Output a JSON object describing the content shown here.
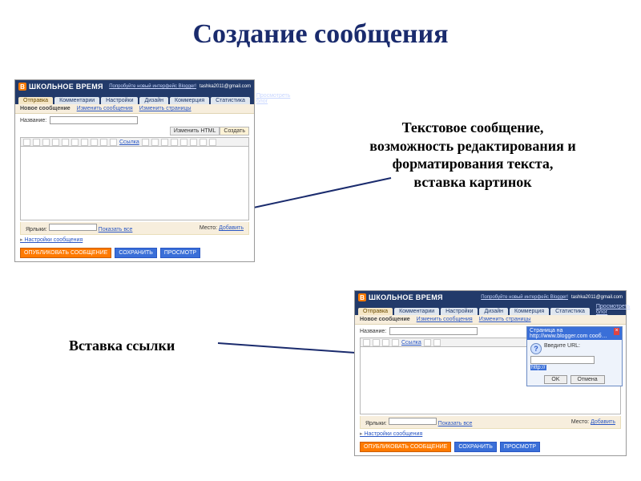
{
  "title": "Создание сообщения",
  "annotation1": "Текстовое сообщение, возможность редактирования и форматирования текста, вставка картинок",
  "annotation2": "Вставка ссылки",
  "blogger": {
    "siteName": "ШКОЛЬНОЕ ВРЕМЯ",
    "tryNew": "Попробуйте новый интерфейс Blogger!",
    "email": "tashka2011@gmail.com",
    "tabs": {
      "posting": "Отправка",
      "comments": "Комментарии",
      "settings": "Настройки",
      "design": "Дизайн",
      "monetize": "Коммерция",
      "stats": "Статистика"
    },
    "viewBlog": "Просмотреть блог",
    "sub": {
      "newPost": "Новое сообщение",
      "editPosts": "Изменить сообщения",
      "editPages": "Изменить страницы"
    },
    "titleLabel": "Название:",
    "mode": {
      "html": "Изменить HTML",
      "compose": "Создать"
    },
    "toolbar": {
      "link": "Ссылка"
    },
    "footer": {
      "tagsLabel": "Ярлыки:",
      "showAll": "Показать все",
      "placeLabel": "Место:",
      "addPlace": "Добавить"
    },
    "postOptions": "Настройки сообщения",
    "actions": {
      "publish": "ОПУБЛИКОВАТЬ СООБЩЕНИЕ",
      "save": "СОХРАНИТЬ",
      "preview": "ПРОСМОТР"
    }
  },
  "dialog": {
    "title": "Страница на http://www.blogger.com сооб…",
    "prompt": "Введите URL:",
    "value": "http://",
    "ok": "OK",
    "cancel": "Отмена"
  }
}
